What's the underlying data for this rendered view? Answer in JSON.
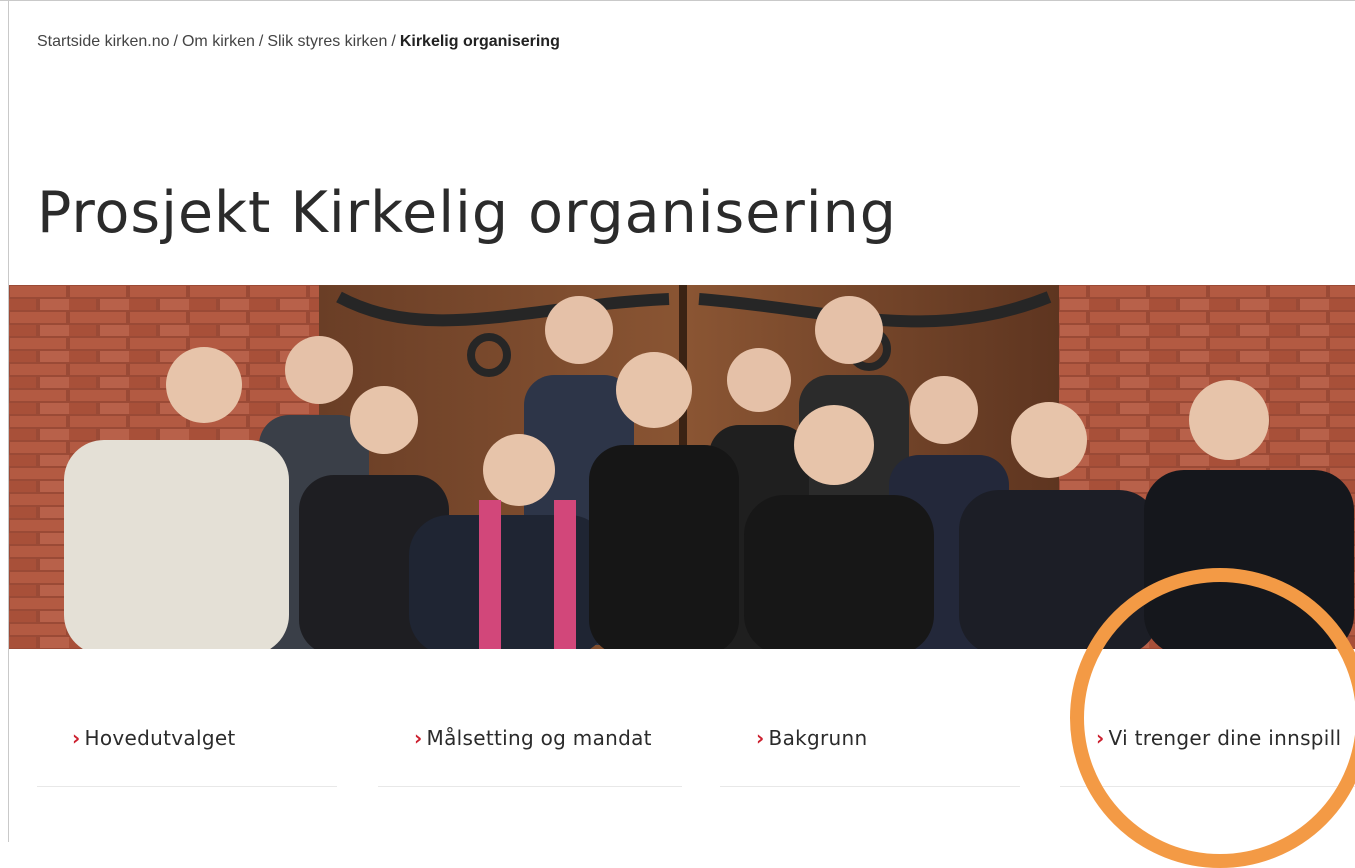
{
  "breadcrumb": {
    "items": [
      "Startside kirken.no",
      "Om kirken",
      "Slik styres kirken"
    ],
    "separator": "/",
    "current": "Kirkelig organisering"
  },
  "page": {
    "title": "Prosjekt Kirkelig organisering"
  },
  "hero": {
    "subject": "group-photo"
  },
  "tiles": [
    {
      "label": "Hovedutvalget"
    },
    {
      "label": "Målsetting og mandat"
    },
    {
      "label": "Bakgrunn"
    },
    {
      "label": "Vi trenger dine innspill"
    }
  ],
  "colors": {
    "accent": "#cc1f2e",
    "annotation": "#f39a45",
    "text": "#2b2b2b"
  },
  "icons": {
    "link_chevron": "chevron-right-icon"
  }
}
